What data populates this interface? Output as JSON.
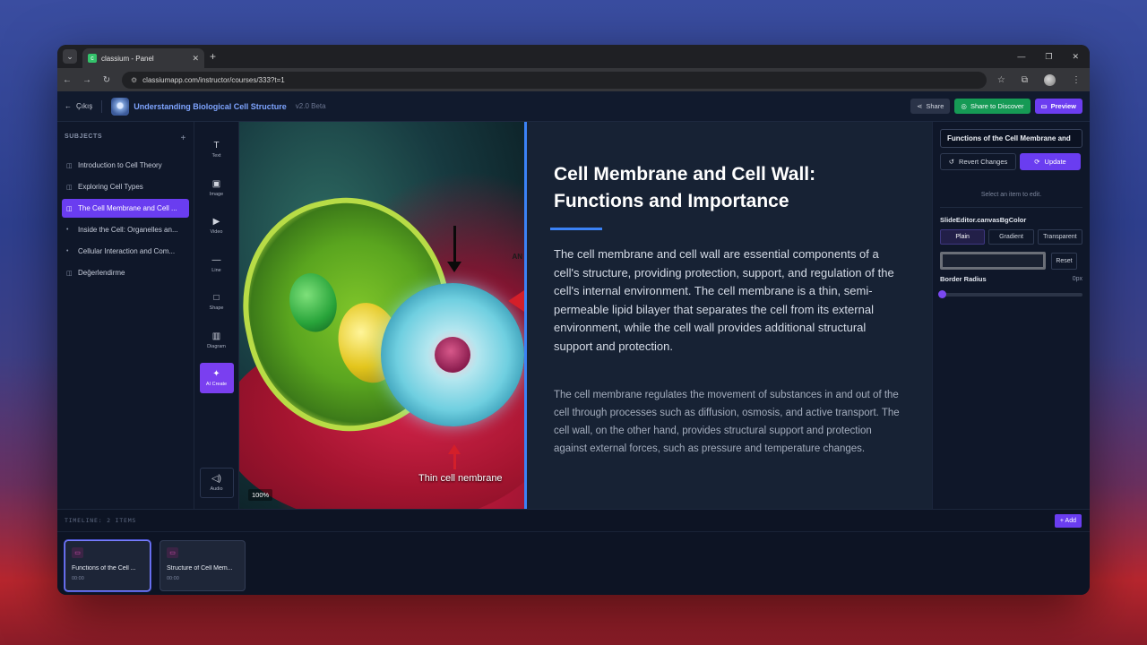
{
  "browser": {
    "tab_title": "classium - Panel",
    "url": "classiumapp.com/instructor/courses/333?t=1"
  },
  "header": {
    "back_label": "Çıkış",
    "course_title": "Understanding Biological Cell Structure",
    "version": "v2.0 Beta",
    "share_label": "Share",
    "discover_label": "Share to Discover",
    "preview_label": "Preview"
  },
  "sidebar": {
    "heading": "SUBJECTS",
    "items": [
      {
        "label": "Introduction to Cell Theory",
        "active": false
      },
      {
        "label": "Exploring Cell Types",
        "active": false
      },
      {
        "label": "The Cell Membrane and Cell ...",
        "active": true
      },
      {
        "label": "Inside the Cell: Organelles an...",
        "active": false
      },
      {
        "label": "Cellular Interaction and Com...",
        "active": false
      },
      {
        "label": "Değerlendirme",
        "active": false
      }
    ]
  },
  "tools": {
    "text": "Text",
    "image": "Image",
    "video": "Video",
    "line": "Line",
    "shape": "Shape",
    "diagram": "Diagram",
    "ai_create": "AI Create",
    "audio": "Audio"
  },
  "slide": {
    "image_annotation": "AN",
    "image_caption": "Thin cell nembrane",
    "zoom": "100%",
    "title": "Cell Membrane and Cell Wall: Functions and Importance",
    "paragraph_1": "The cell membrane and cell wall are essential components of a cell's structure, providing protection, support, and regulation of the cell's internal environment. The cell membrane is a thin, semi-permeable lipid bilayer that separates the cell from its external environment, while the cell wall provides additional structural support and protection.",
    "paragraph_2": "The cell membrane regulates the movement of substances in and out of the cell through processes such as diffusion, osmosis, and active transport. The cell wall, on the other hand, provides structural support and protection against external forces, such as pressure and temperature changes.",
    "accent_color": "#3b82f6"
  },
  "right_panel": {
    "item_name": "Functions of the Cell Membrane and",
    "revert_label": "Revert Changes",
    "update_label": "Update",
    "hint": "Select an item to edit.",
    "bg_label": "SlideEditor.canvasBgColor",
    "bg_modes": [
      "Plain",
      "Gradient",
      "Transparent"
    ],
    "bg_mode_selected": "Plain",
    "reset_label": "Reset",
    "border_radius_label": "Border Radius",
    "border_radius_value": "0px"
  },
  "timeline": {
    "title": "TIMELINE: 2 ITEMS",
    "add_label": "+ Add",
    "cards": [
      {
        "title": "Functions of the Cell ...",
        "time": "00:00",
        "selected": true
      },
      {
        "title": "Structure of Cell Mem...",
        "time": "00:00",
        "selected": false
      }
    ]
  }
}
